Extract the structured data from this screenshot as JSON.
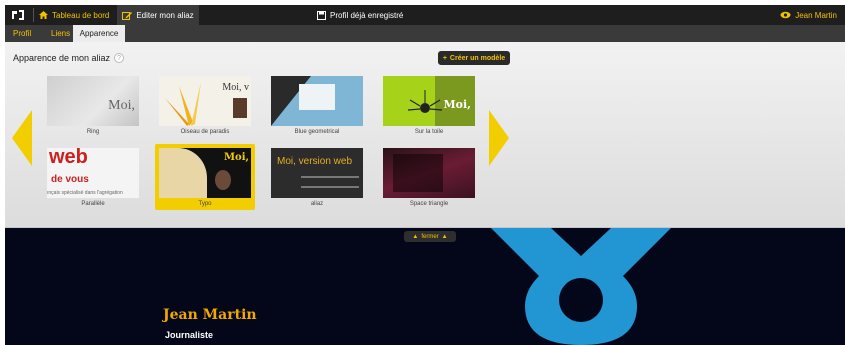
{
  "topbar": {
    "tab_dashboard": "Tableau de bord",
    "tab_editor": "Editer mon aliaz",
    "status": "Profil déjà enregistré",
    "user": "Jean Martin"
  },
  "subnav": [
    "Profil",
    "Liens",
    "Apparence"
  ],
  "panel": {
    "title": "Apparence de mon aliaz",
    "create_button": "Créer un modèle",
    "themes": [
      {
        "label": "Ring",
        "text": "Moi,"
      },
      {
        "label": "Oiseau de paradis",
        "text": "Moi, v"
      },
      {
        "label": "Blue geometrical"
      },
      {
        "label": "Sur la toile",
        "text": "Moi,"
      },
      {
        "label": "Parallèle",
        "web": "web",
        "devous": "de vous",
        "small": "ınçais spécialisé dans l'agrégation"
      },
      {
        "label": "Typo",
        "text": "Moi,"
      },
      {
        "label": "aliaz",
        "text": "Moi, version web"
      },
      {
        "label": "Space triangle"
      }
    ]
  },
  "toggle": {
    "label": "fermer"
  },
  "preview": {
    "name": "Jean Martin",
    "role": "Journaliste",
    "shape_color": "#2196d3",
    "background": "#04061a"
  },
  "colors": {
    "accent": "#f2c200",
    "bar_dark": "#1e1e1e"
  }
}
